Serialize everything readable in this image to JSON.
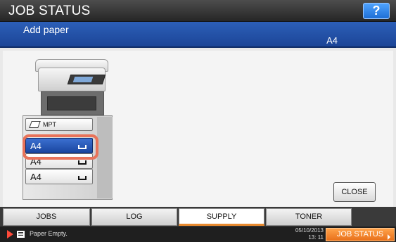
{
  "title": "JOB STATUS",
  "help_label": "?",
  "message": "Add paper",
  "paper_size": "A4",
  "copier": {
    "drawers": [
      {
        "label": "MPT",
        "selected": false
      },
      {
        "label": "A4",
        "selected": true
      },
      {
        "label": "A4",
        "selected": false
      },
      {
        "label": "A4",
        "selected": false
      }
    ]
  },
  "close_label": "CLOSE",
  "tabs": [
    {
      "label": "JOBS",
      "active": false
    },
    {
      "label": "LOG",
      "active": false
    },
    {
      "label": "SUPPLY",
      "active": true
    },
    {
      "label": "TONER",
      "active": false
    }
  ],
  "status": {
    "message": "Paper Empty.",
    "date": "05/10/2013",
    "time": "13: 11",
    "job_status_label": "JOB STATUS"
  },
  "colors": {
    "title_bar": "#333333",
    "message_bar": "#2456ad",
    "selected_drawer": "#2a5cbf",
    "highlight": "#e8735a",
    "active_tab_underline": "#e88a2e",
    "job_status_button": "#f2801f",
    "alert_arrow": "#ff4a3a"
  }
}
